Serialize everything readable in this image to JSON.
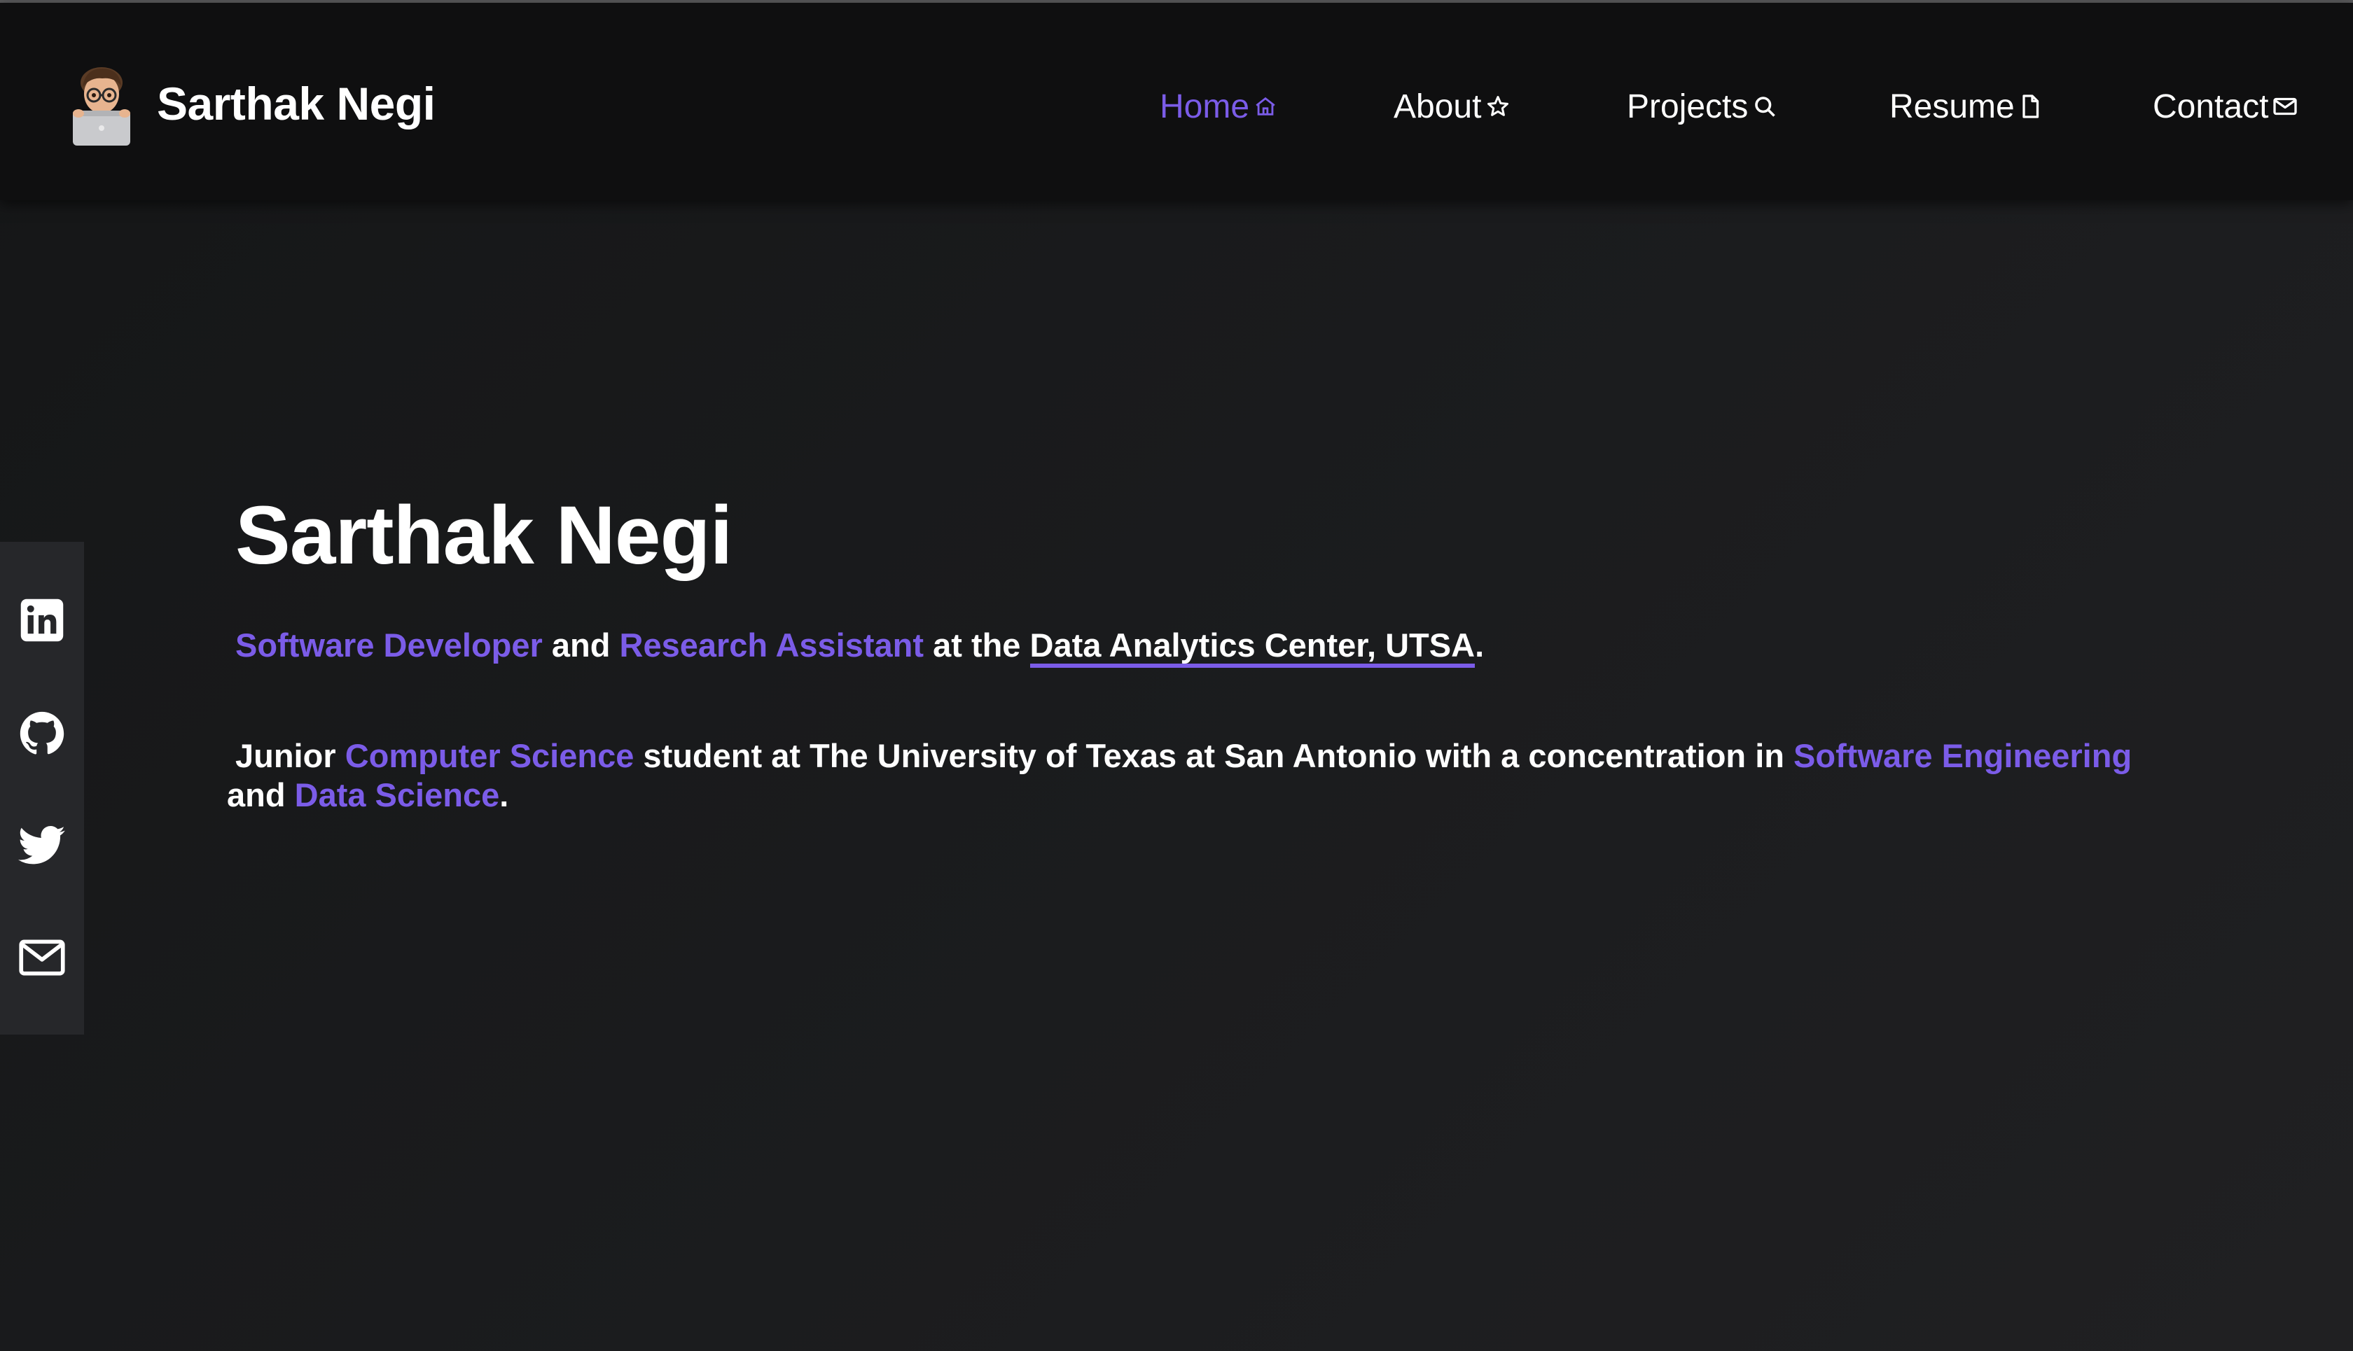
{
  "brand": {
    "name": "Sarthak Negi",
    "avatar_icon": "memoji-avatar-icon"
  },
  "nav": {
    "items": [
      {
        "label": "Home",
        "icon": "home-icon",
        "active": true
      },
      {
        "label": "About",
        "icon": "star-icon",
        "active": false
      },
      {
        "label": "Projects",
        "icon": "search-icon",
        "active": false
      },
      {
        "label": "Resume",
        "icon": "document-icon",
        "active": false
      },
      {
        "label": "Contact",
        "icon": "mail-icon",
        "active": false
      }
    ]
  },
  "social": {
    "items": [
      {
        "icon": "linkedin-icon"
      },
      {
        "icon": "github-icon"
      },
      {
        "icon": "twitter-icon"
      },
      {
        "icon": "mail-icon"
      }
    ]
  },
  "hero": {
    "title": "Sarthak Negi",
    "line1": {
      "role1": "Software Developer",
      "and": " and ",
      "role2": "Research Assistant",
      "at": " at the ",
      "org": "Data Analytics Center, UTSA",
      "end": "."
    },
    "line2": {
      "pre": "Junior ",
      "major": "Computer Science",
      "mid": " student at The University of Texas at San Antonio with a concentration in ",
      "conc1": "Software Engineering",
      "and": " and ",
      "conc2": "Data Science",
      "end": "."
    }
  },
  "colors": {
    "accent": "#7b5ce8",
    "nav_bg": "#0f0f10",
    "page_bg": "#1a1b1d",
    "sidebar_bg": "#26272a",
    "text": "#ffffff"
  }
}
